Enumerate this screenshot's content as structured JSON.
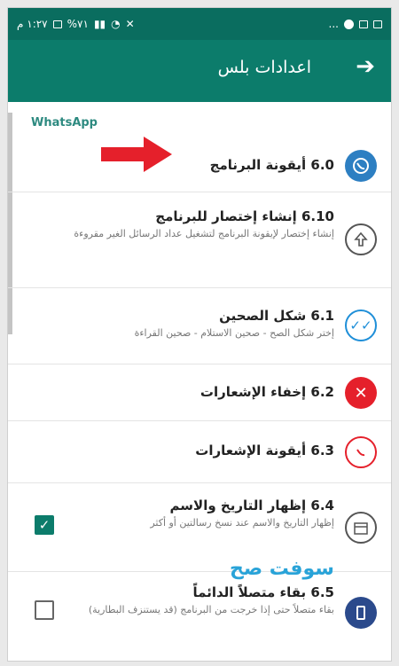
{
  "status_bar": {
    "time": "١:٢٧ م",
    "battery": "%٧١",
    "dots": "..."
  },
  "app_bar": {
    "title": "اعدادات بلس",
    "back_icon": "arrow-right"
  },
  "category": "WhatsApp",
  "items": [
    {
      "title": "6.0 أيقونة البرنامج",
      "subtitle": "",
      "icon": "whatsapp-blue-icon"
    },
    {
      "title": "6.10 إنشاء إختصار للبرنامج",
      "subtitle": "إنشاء إختصار لإيقونة البرنامج لتشغيل عداد الرسائل الغير مقروءة",
      "icon": "shortcut-arrow-icon"
    },
    {
      "title": "6.1 شكل الصحين",
      "subtitle": "إختر شكل الصح - صحين الاستلام - صحين القراءة",
      "icon": "double-check-icon"
    },
    {
      "title": "6.2 إخفاء الإشعارات",
      "subtitle": "",
      "icon": "red-x-icon"
    },
    {
      "title": "6.3 أيقونة الإشعارات",
      "subtitle": "",
      "icon": "whatsapp-red-icon"
    },
    {
      "title": "6.4 إظهار التاريخ والاسم",
      "subtitle": "إظهار التاريخ والاسم عند نسخ رسالتين أو أكثر",
      "icon": "calendar-icon",
      "checked": true
    },
    {
      "title": "6.5 بقاء متصلاً الدائماً",
      "subtitle": "بقاء متصلاً حتى إذا خرجت من البرنامج (قد يستنزف البطارية)",
      "icon": "phone-icon",
      "checked": false
    }
  ],
  "watermark": "سوفت صح",
  "colors": {
    "primary": "#0c7c6b",
    "status": "#0a6d5f",
    "accent_red": "#e5202b"
  }
}
